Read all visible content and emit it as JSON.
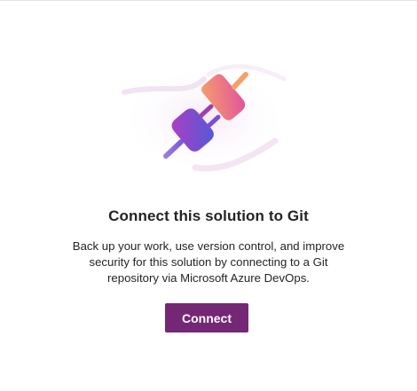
{
  "dialog": {
    "title": "Connect this solution to Git",
    "description": "Back up your work, use version control, and improve security for this solution by connecting to a Git repository via Microsoft Azure DevOps.",
    "connect_label": "Connect",
    "illustration_icon": "plug-connect-icon"
  },
  "colors": {
    "primary_button": "#742774",
    "text": "#242424",
    "plug_left_start": "#9b3fb0",
    "plug_left_end": "#4f5ad8",
    "plug_right_start": "#f28b6a",
    "plug_right_end": "#e5519b"
  }
}
